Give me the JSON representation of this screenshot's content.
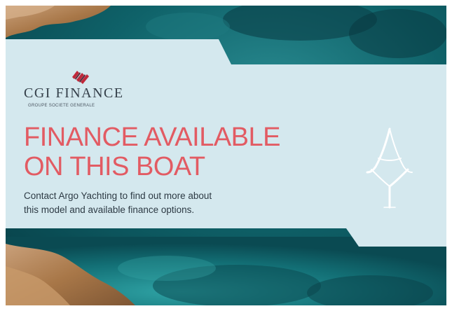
{
  "ad": {
    "logo": {
      "name": "CGI FINANCE",
      "tagline": "GROUPE SOCIETE GENERALE"
    },
    "headline": {
      "line1": "FINANCE AVAILABLE",
      "line2": "ON THIS BOAT"
    },
    "body": {
      "line1": "Contact Argo Yachting to find out more about",
      "line2": "this model and available finance options."
    },
    "brand_mark": "argo-yachting-monogram-icon"
  },
  "colors": {
    "panel": "#d4e8ee",
    "headline": "#e25b63",
    "sea": "#0f5e66",
    "rock": "#b48356",
    "logo_mark": "#c0283a"
  }
}
